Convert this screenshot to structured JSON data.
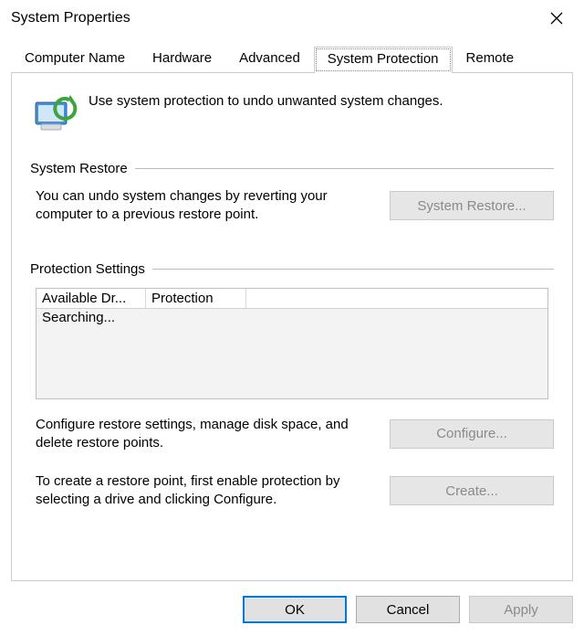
{
  "title": "System Properties",
  "tabs": [
    "Computer Name",
    "Hardware",
    "Advanced",
    "System Protection",
    "Remote"
  ],
  "activeTab": 3,
  "intro": "Use system protection to undo unwanted system changes.",
  "restore": {
    "legend": "System Restore",
    "desc": "You can undo system changes by reverting your computer to a previous restore point.",
    "button": "System Restore..."
  },
  "protection": {
    "legend": "Protection Settings",
    "columns": [
      "Available Dr...",
      "Protection"
    ],
    "status": "Searching...",
    "configure": {
      "desc": "Configure restore settings, manage disk space, and delete restore points.",
      "button": "Configure..."
    },
    "create": {
      "desc": "To create a restore point, first enable protection by selecting a drive and clicking Configure.",
      "button": "Create..."
    }
  },
  "footer": {
    "ok": "OK",
    "cancel": "Cancel",
    "apply": "Apply"
  }
}
